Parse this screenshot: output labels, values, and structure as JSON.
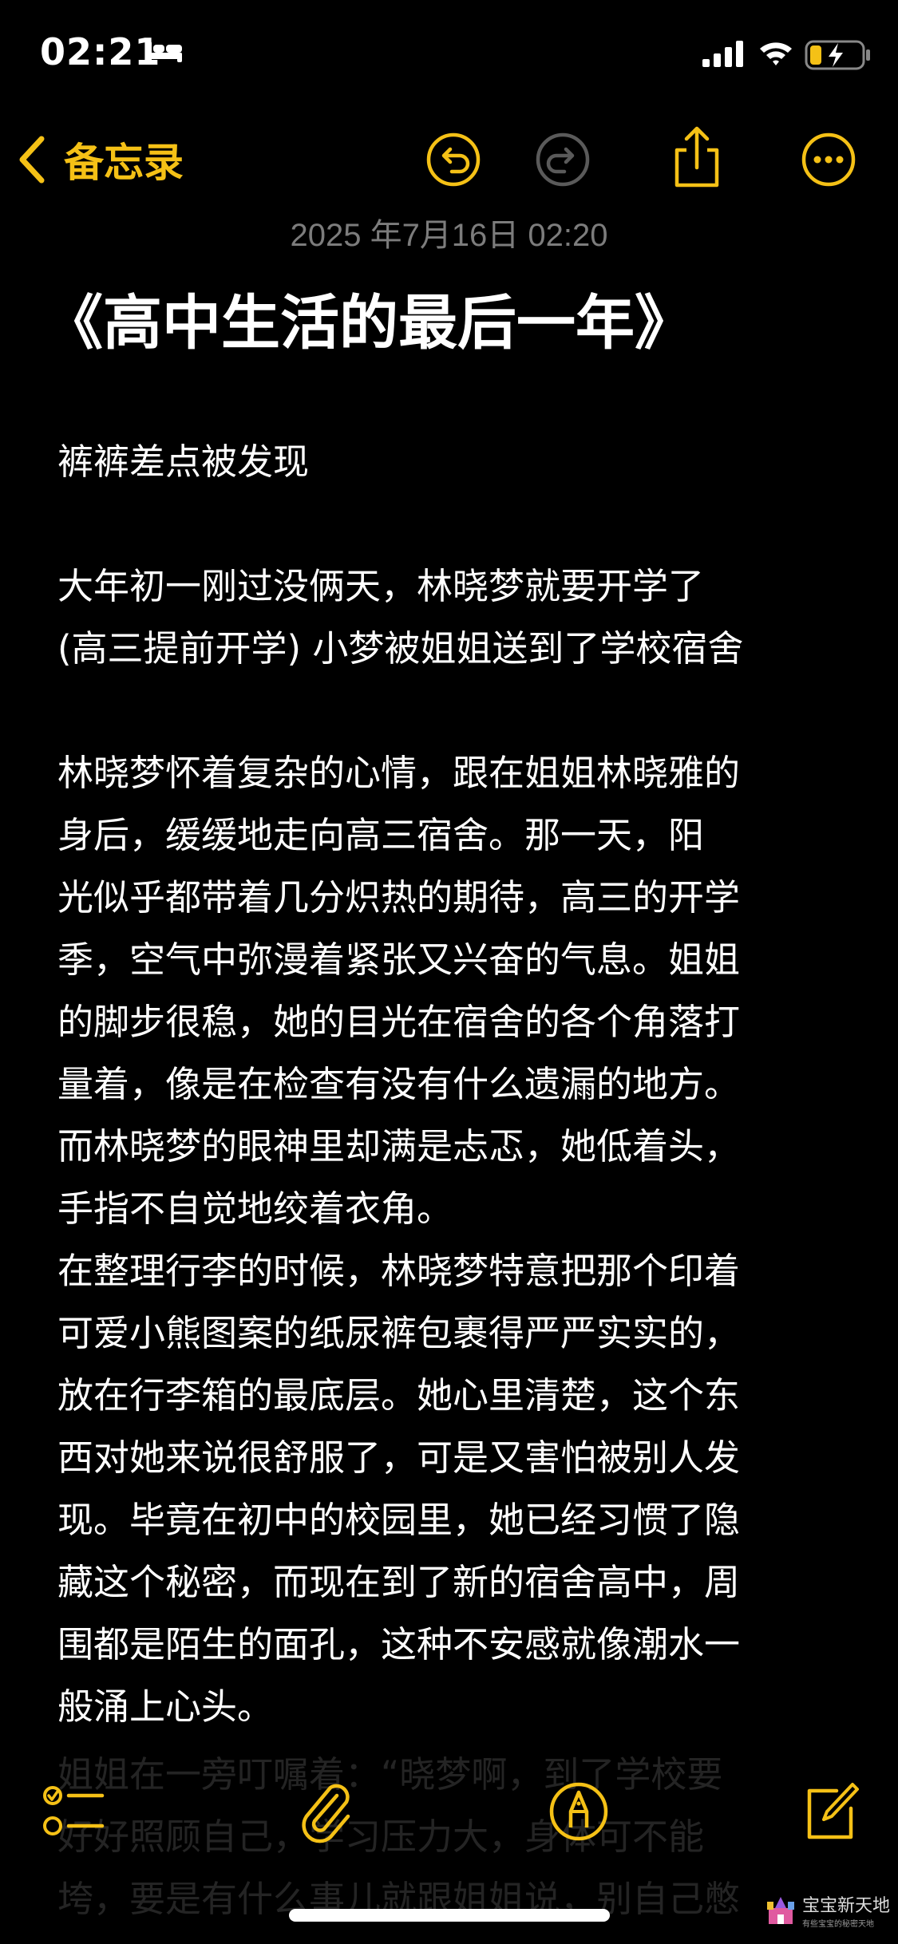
{
  "status_bar": {
    "time": "02:21",
    "icons": [
      "bed-icon",
      "signal-icon",
      "wifi-icon",
      "battery-charging-icon"
    ]
  },
  "nav": {
    "back_label": "备忘录",
    "icons": [
      "chevron-left-icon",
      "undo-icon",
      "redo-icon",
      "share-icon",
      "more-icon"
    ]
  },
  "note": {
    "date": "2025 年7月16日 02:20",
    "title": "《高中生活的最后一年》",
    "paragraphs": [
      [
        "裤裤差点被发现"
      ],
      [
        "大年初一刚过没俩天，林晓梦就要开学了",
        "(高三提前开学) 小梦被姐姐送到了学校宿舍"
      ],
      [
        "林晓梦怀着复杂的心情，跟在姐姐林晓雅的",
        "身后，缓缓地走向高三宿舍。那一天，阳",
        "光似乎都带着几分炽热的期待，高三的开学",
        "季，空气中弥漫着紧张又兴奋的气息。姐姐",
        "的脚步很稳，她的目光在宿舍的各个角落打",
        "量着，像是在检查有没有什么遗漏的地方。",
        "而林晓梦的眼神里却满是忐忑，她低着头，",
        "手指不自觉地绞着衣角。",
        "在整理行李的时候，林晓梦特意把那个印着",
        "可爱小熊图案的纸尿裤包裹得严严实实的，",
        "放在行李箱的最底层。她心里清楚，这个东",
        "西对她来说很舒服了，可是又害怕被别人发",
        "现。毕竟在初中的校园里，她已经习惯了隐",
        "藏这个秘密，而现在到了新的宿舍高中，周",
        "围都是陌生的面孔，这种不安感就像潮水一",
        "般涌上心头。"
      ]
    ],
    "faded_lines": [
      "姐姐在一旁叮嘱着：“晓梦啊，到了学校要",
      "好好照顾自己，学习压力大，身体可不能",
      "垮，要是有什么事儿就跟姐姐说，别自己憋"
    ]
  },
  "toolbar": {
    "icons": [
      "checklist-icon",
      "paperclip-icon",
      "markup-pen-icon",
      "compose-icon"
    ]
  },
  "watermark": {
    "text": "宝宝新天地",
    "subtext": "有些宝宝的秘密天地"
  },
  "colors": {
    "accent": "#f5c116",
    "background": "#000000",
    "text": "#ffffff",
    "date": "#7c7c7c",
    "disabled": "#5a5a5a"
  }
}
